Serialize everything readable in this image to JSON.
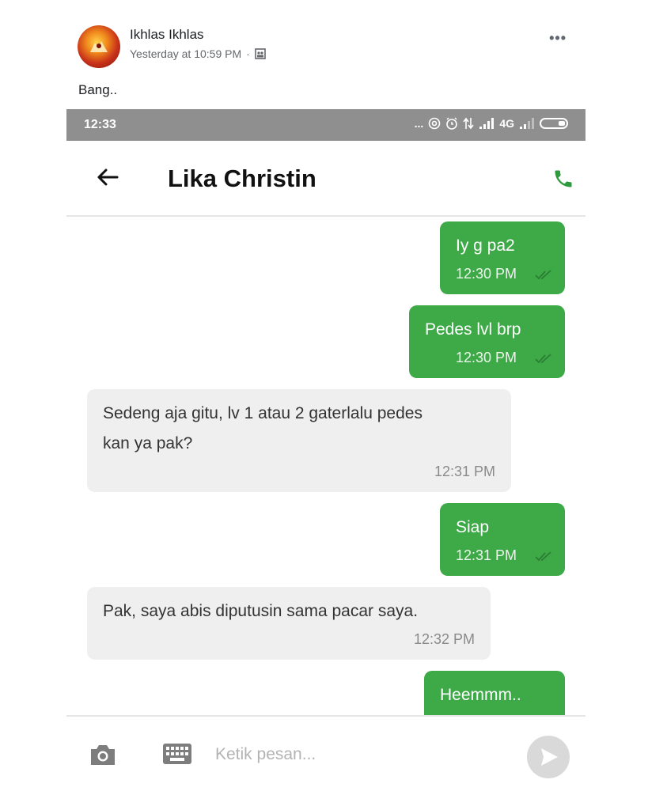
{
  "post": {
    "author": "Ikhlas Ikhlas",
    "timestamp": "Yesterday at 10:59 PM",
    "separator": "·",
    "privacy_icon": "group-audience-icon",
    "more_icon": "ellipsis-icon",
    "more_label": "•••",
    "text": "Bang.."
  },
  "phone": {
    "status_bar": {
      "time": "12:33",
      "dots": "...",
      "network": "4G",
      "icons": [
        "hotspot-icon",
        "alarm-icon",
        "data-arrows-icon",
        "signal-icon",
        "signal-weak-icon",
        "battery-icon"
      ]
    },
    "app_bar": {
      "back_icon": "arrow-left-icon",
      "back_label": "←",
      "contact_name": "Lika Christin",
      "call_icon": "phone-icon"
    },
    "messages": [
      {
        "direction": "out",
        "text": "Iy g pa2",
        "time": "12:30 PM",
        "read": true
      },
      {
        "direction": "out",
        "text": "Pedes lvl brp",
        "time": "12:30 PM",
        "read": true
      },
      {
        "direction": "in",
        "text_line1": "Sedeng aja gitu, lv 1 atau 2 gaterlalu pedes",
        "text_line2": "kan ya pak?",
        "time": "12:31 PM"
      },
      {
        "direction": "out",
        "text": "Siap",
        "time": "12:31 PM",
        "read": true
      },
      {
        "direction": "in",
        "text": "Pak, saya abis diputusin sama pacar saya.",
        "time": "12:32 PM"
      },
      {
        "direction": "out",
        "text": "Heemmm.."
      }
    ],
    "composer": {
      "camera_icon": "camera-icon",
      "keyboard_icon": "keyboard-icon",
      "placeholder": "Ketik pesan...",
      "value": "",
      "send_icon": "send-icon"
    }
  },
  "colors": {
    "outgoing_bubble": "#3daa47",
    "incoming_bubble": "#efefef",
    "status_bar": "#8f8f8f",
    "call_icon": "#2e9a3e"
  }
}
